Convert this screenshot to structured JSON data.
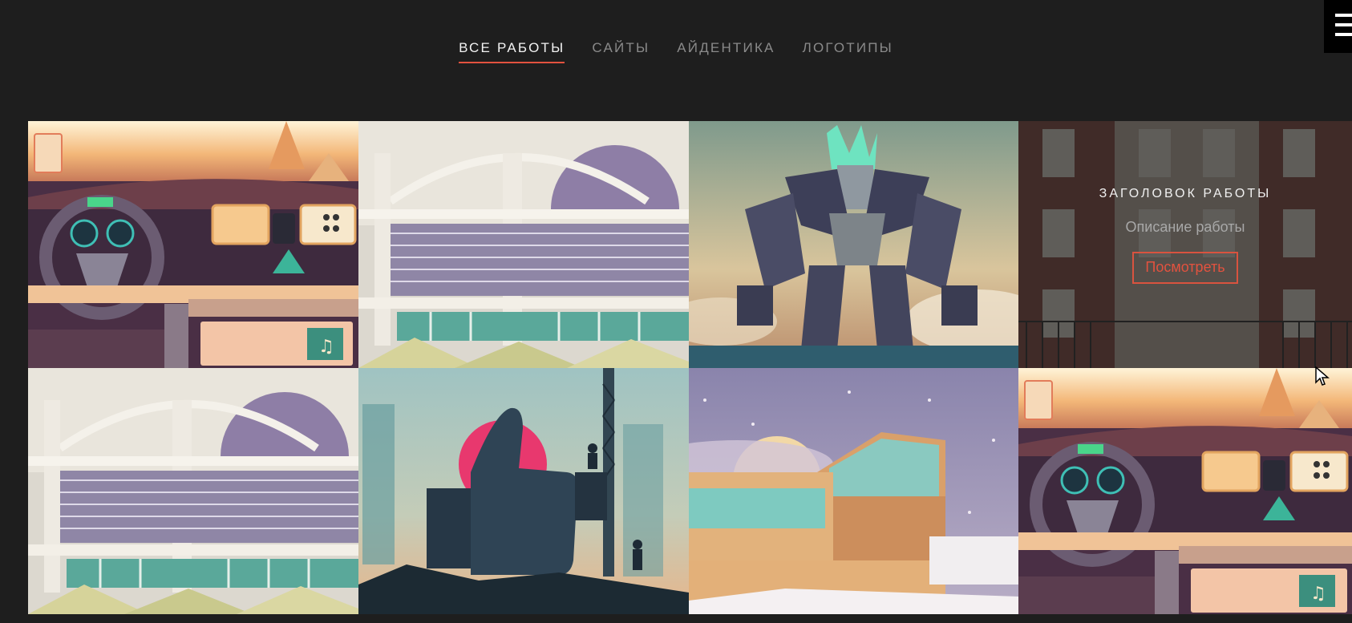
{
  "filters": [
    {
      "label": "ВСЕ РАБОТЫ",
      "active": true
    },
    {
      "label": "САЙТЫ",
      "active": false
    },
    {
      "label": "АЙДЕНТИКА",
      "active": false
    },
    {
      "label": "ЛОГОТИПЫ",
      "active": false
    }
  ],
  "menu_icon": "hamburger-icon",
  "hover_overlay": {
    "title": "ЗАГОЛОВОК РАБОТЫ",
    "description": "Описание работы",
    "button_label": "Посмотреть"
  },
  "portfolio": [
    {
      "illustration": "car-dashboard"
    },
    {
      "illustration": "stadium"
    },
    {
      "illustration": "robot"
    },
    {
      "illustration": "brick-building"
    },
    {
      "illustration": "stadium"
    },
    {
      "illustration": "thumbs-up-construction"
    },
    {
      "illustration": "modern-building-snow"
    },
    {
      "illustration": "car-dashboard"
    }
  ],
  "colors": {
    "background": "#1e1e1e",
    "accent": "#e2523f",
    "active_text": "#f2f2f2",
    "inactive_text": "#8a8a8a"
  }
}
